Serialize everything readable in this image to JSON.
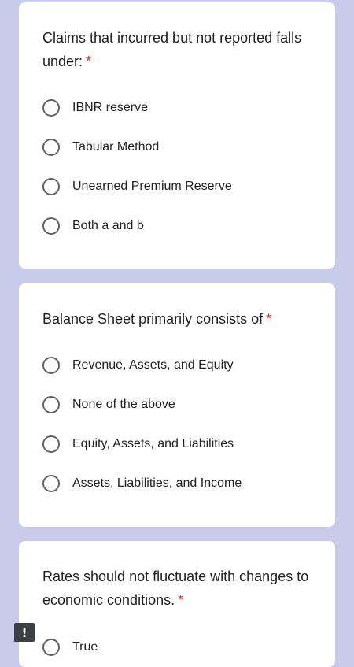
{
  "questions": [
    {
      "text": "Claims that incurred but not reported falls under:",
      "required_mark": "*",
      "options": [
        "IBNR reserve",
        "Tabular Method",
        "Unearned Premium Reserve",
        "Both a and b"
      ]
    },
    {
      "text": "Balance Sheet primarily consists of",
      "required_mark": "*",
      "options": [
        "Revenue, Assets, and Equity",
        "None of the above",
        "Equity, Assets, and Liabilities",
        "Assets, Liabilities, and Income"
      ]
    },
    {
      "text": "Rates should not fluctuate with changes to economic conditions.",
      "required_mark": "*",
      "options": [
        "True"
      ]
    }
  ],
  "report_button": {
    "icon": "exclamation-icon",
    "glyph": "!"
  },
  "colors": {
    "background": "#c9cbea",
    "card": "#ffffff",
    "required": "#d93025",
    "radio_border": "#5f6368"
  }
}
